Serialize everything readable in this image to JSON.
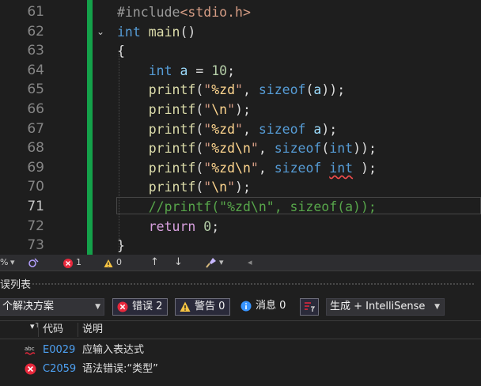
{
  "editor": {
    "lines": [
      {
        "num": "61",
        "code": [
          "<span class=\"p\">#include</span><span class=\"s\">&lt;stdio.h&gt;</span>"
        ]
      },
      {
        "num": "62",
        "fold": "⌄",
        "code": [
          "<span class=\"k\">int</span> <span class=\"f\">main</span>()"
        ]
      },
      {
        "num": "63",
        "code": [
          "{"
        ]
      },
      {
        "num": "64",
        "code": [
          "    <span class=\"k\">int</span> <span class=\"v\">a</span> = <span class=\"n\">10</span>;"
        ]
      },
      {
        "num": "65",
        "code": [
          "    <span class=\"f\">printf</span>(<span class=\"s\">\"</span><span class=\"e\">%zd</span><span class=\"s\">\"</span>, <span class=\"k\">sizeof</span>(<span class=\"v\">a</span>));"
        ]
      },
      {
        "num": "66",
        "code": [
          "    <span class=\"f\">printf</span>(<span class=\"s\">\"</span><span class=\"e\">\\n</span><span class=\"s\">\"</span>);"
        ]
      },
      {
        "num": "67",
        "code": [
          "    <span class=\"f\">printf</span>(<span class=\"s\">\"</span><span class=\"e\">%zd</span><span class=\"s\">\"</span>, <span class=\"k\">sizeof</span> <span class=\"v\">a</span>);"
        ]
      },
      {
        "num": "68",
        "code": [
          "    <span class=\"f\">printf</span>(<span class=\"s\">\"</span><span class=\"e\">%zd\\n</span><span class=\"s\">\"</span>, <span class=\"k\">sizeof</span>(<span class=\"k\">int</span>));"
        ]
      },
      {
        "num": "69",
        "code": [
          "    <span class=\"f\">printf</span>(<span class=\"s\">\"</span><span class=\"e\">%zd\\n</span><span class=\"s\">\"</span>, <span class=\"k\">sizeof</span> <span class=\"k squig\">int</span> );"
        ]
      },
      {
        "num": "70",
        "code": [
          "    <span class=\"f\">printf</span>(<span class=\"s\">\"</span><span class=\"e\">\\n</span><span class=\"s\">\"</span>);"
        ]
      },
      {
        "num": "71",
        "current": true,
        "code": [
          "    <span class=\"c\">//printf(\"%zd\\n\", sizeof(a));</span>"
        ]
      },
      {
        "num": "72",
        "code": [
          "    <span class=\"r\">return</span> <span class=\"n\">0</span>;"
        ]
      },
      {
        "num": "73",
        "code": [
          "}"
        ]
      }
    ]
  },
  "status": {
    "zoom": "%",
    "errors": "1",
    "warnings": "0"
  },
  "panel": {
    "title": "误列表",
    "scope": "个解决方案",
    "errors_label": "错误 2",
    "warnings_label": "警告 0",
    "messages_label": "消息 0",
    "build_source": "生成 + IntelliSense",
    "col_code": "代码",
    "col_desc": "说明",
    "rows": [
      {
        "type": "abc",
        "code": "E0029",
        "desc": "应输入表达式"
      },
      {
        "type": "error",
        "code": "C2059",
        "desc": "语法错误:“类型”"
      }
    ]
  },
  "colors": {
    "background": "#1e1e1e",
    "change_bar": "#14a14a",
    "keyword": "#569cd6",
    "function": "#dcdcaa",
    "string": "#d69d85",
    "comment": "#57a64a",
    "error": "#e8283c"
  }
}
